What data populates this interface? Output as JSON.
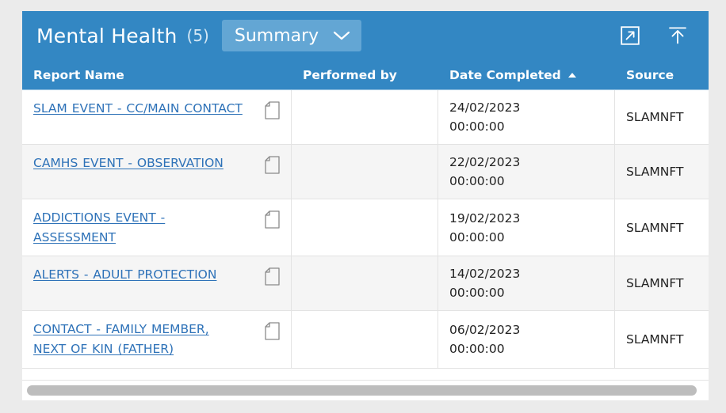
{
  "panel": {
    "title": "Mental Health",
    "count": "(5)",
    "view_selector": {
      "label": "Summary",
      "chevron_icon": "chevron-down-icon"
    },
    "actions": [
      {
        "name": "open-in-new-window-icon",
        "tooltip": "Open in new window"
      },
      {
        "name": "collapse-up-icon",
        "tooltip": "Collapse"
      }
    ],
    "accent_color": "#3387c3",
    "pill_color": "#63a6d4",
    "link_color": "#2e72b8"
  },
  "table": {
    "columns": [
      {
        "label": "Report Name",
        "sorted": false
      },
      {
        "label": "Performed by",
        "sorted": false
      },
      {
        "label": "Date Completed",
        "sorted": true,
        "sort_direction": "asc",
        "sort_icon": "sort-ascending-icon"
      },
      {
        "label": "Source",
        "sorted": false
      }
    ],
    "rows": [
      {
        "report_name": "SLAM EVENT - CC/MAIN CONTACT",
        "doc_icon": "document-icon",
        "performed_by": "",
        "date_completed": "24/02/2023\n00:00:00",
        "source": "SLAMNFT"
      },
      {
        "report_name": "CAMHS EVENT - OBSERVATION",
        "doc_icon": "document-icon",
        "performed_by": "",
        "date_completed": "22/02/2023\n00:00:00",
        "source": "SLAMNFT"
      },
      {
        "report_name": "ADDICTIONS EVENT - ASSESSMENT",
        "doc_icon": "document-icon",
        "performed_by": "",
        "date_completed": "19/02/2023\n00:00:00",
        "source": "SLAMNFT"
      },
      {
        "report_name": "ALERTS - ADULT PROTECTION",
        "doc_icon": "document-icon",
        "performed_by": "",
        "date_completed": "14/02/2023\n00:00:00",
        "source": "SLAMNFT"
      },
      {
        "report_name": "CONTACT - FAMILY MEMBER, NEXT OF KIN (FATHER)",
        "doc_icon": "document-icon",
        "performed_by": "",
        "date_completed": "06/02/2023\n00:00:00",
        "source": "SLAMNFT"
      }
    ]
  },
  "scrollbar": {
    "orientation": "horizontal",
    "thumb_name": "horizontal-scrollbar-thumb"
  }
}
